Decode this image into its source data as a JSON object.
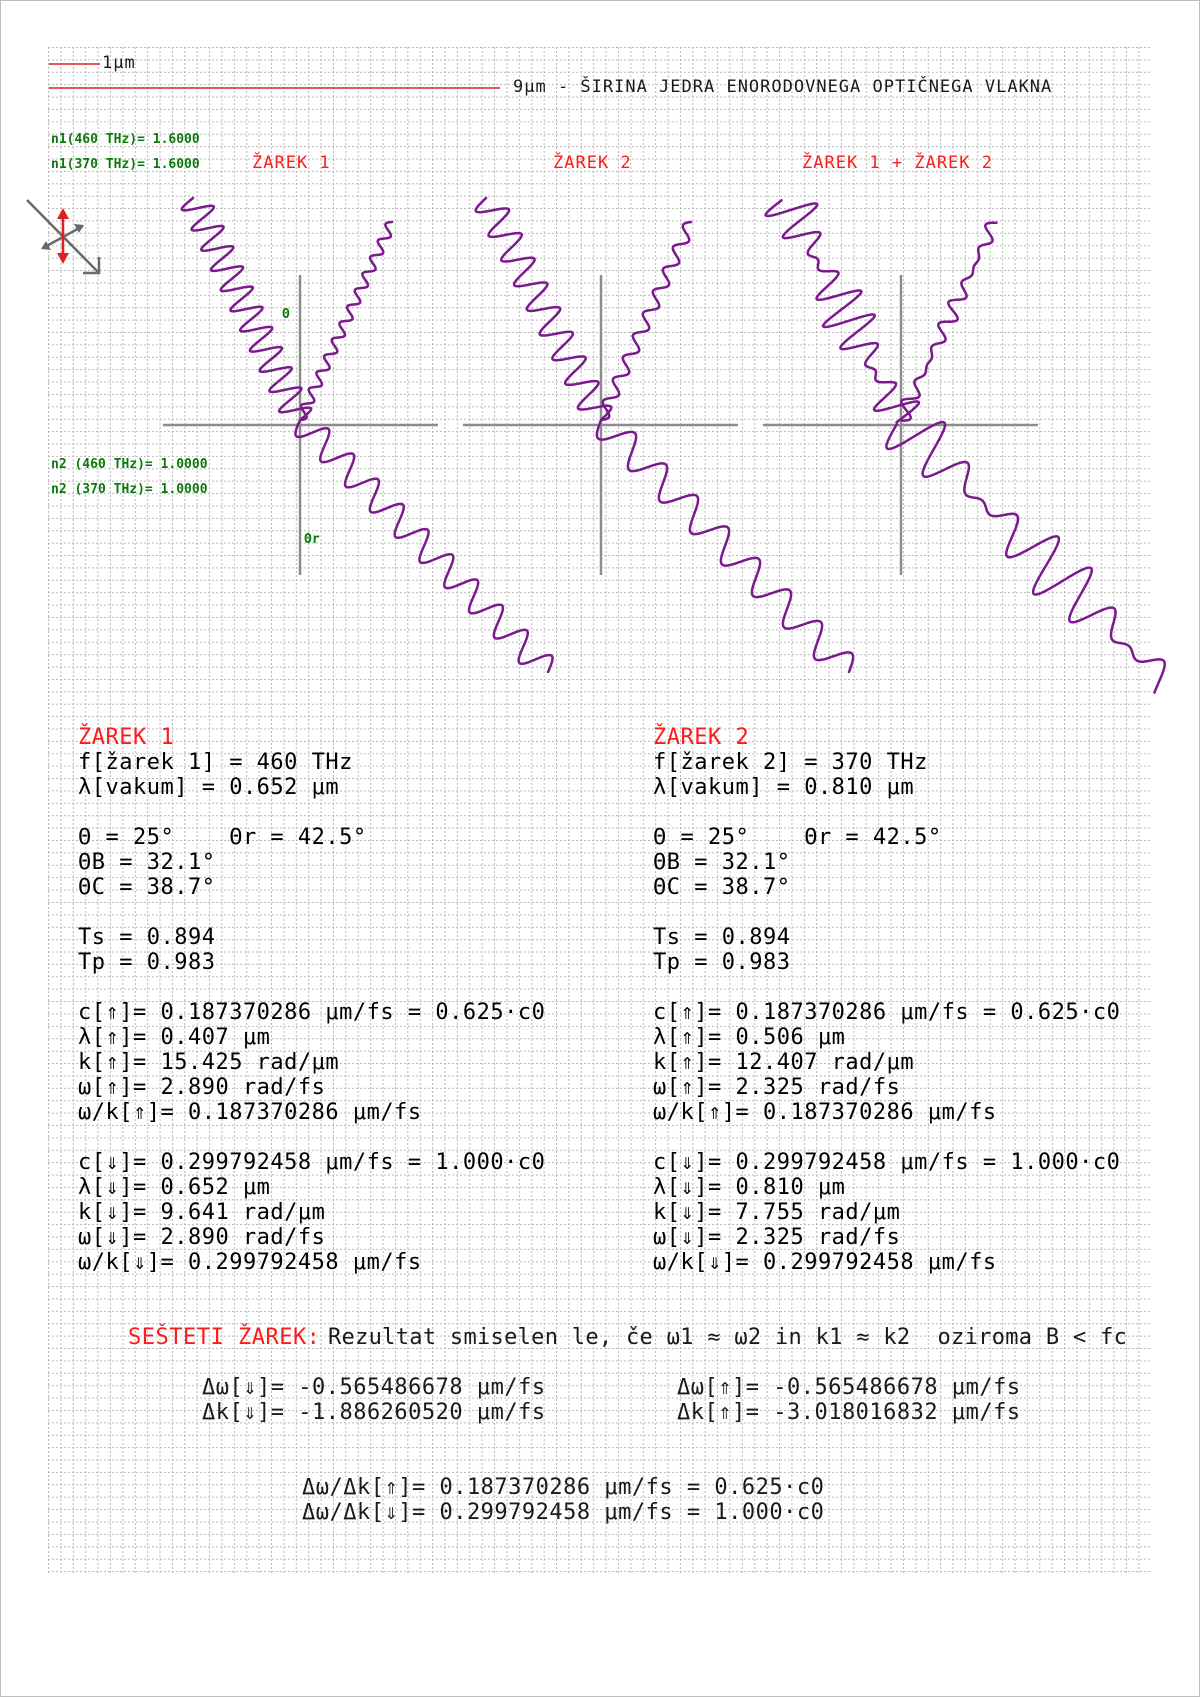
{
  "scale": {
    "small_label": "1μm",
    "large_label": "9μm - ŠIRINA JEDRA ENORODOVNEGA OPTIČNEGA VLAKNA"
  },
  "indices": {
    "n1_460": "n1(460 THz)= 1.6000",
    "n1_370": "n1(370 THz)= 1.6000",
    "n2_460": "n2 (460 THz)= 1.0000",
    "n2_370": "n2 (370 THz)= 1.0000"
  },
  "panels": {
    "p1_title": "ŽAREK 1",
    "p2_title": "ŽAREK 2",
    "p3_title": "ŽAREK 1 + ŽAREK 2",
    "theta_label": "Θ",
    "theta_r_label": "Θr"
  },
  "colors": {
    "wave": "#7a1a8c",
    "title_red": "#ff1a1a",
    "index_green": "#0a7a0a",
    "axis_gray": "#8c8c8c"
  },
  "beam1": {
    "title": "ŽAREK 1",
    "lines": [
      "f[žarek 1] = 460 THz",
      "λ[vakum] = 0.652 μm",
      "",
      "Θ = 25°    Θr = 42.5°",
      "ΘB = 32.1°",
      "ΘC = 38.7°",
      "",
      "Ts = 0.894",
      "Tp = 0.983",
      "",
      "c[⇑]= 0.187370286 μm/fs = 0.625·c0",
      "λ[⇑]= 0.407 μm",
      "k[⇑]= 15.425 rad/μm",
      "ω[⇑]= 2.890 rad/fs",
      "ω/k[⇑]= 0.187370286 μm/fs",
      "",
      "c[⇓]= 0.299792458 μm/fs = 1.000·c0",
      "λ[⇓]= 0.652 μm",
      "k[⇓]= 9.641 rad/μm",
      "ω[⇓]= 2.890 rad/fs",
      "ω/k[⇓]= 0.299792458 μm/fs"
    ]
  },
  "beam2": {
    "title": "ŽAREK 2",
    "lines": [
      "f[žarek 2] = 370 THz",
      "λ[vakum] = 0.810 μm",
      "",
      "Θ = 25°    Θr = 42.5°",
      "ΘB = 32.1°",
      "ΘC = 38.7°",
      "",
      "Ts = 0.894",
      "Tp = 0.983",
      "",
      "c[⇑]= 0.187370286 μm/fs = 0.625·c0",
      "λ[⇑]= 0.506 μm",
      "k[⇑]= 12.407 rad/μm",
      "ω[⇑]= 2.325 rad/fs",
      "ω/k[⇑]= 0.187370286 μm/fs",
      "",
      "c[⇓]= 0.299792458 μm/fs = 1.000·c0",
      "λ[⇓]= 0.810 μm",
      "k[⇓]= 7.755 rad/μm",
      "ω[⇓]= 2.325 rad/fs",
      "ω/k[⇓]= 0.299792458 μm/fs"
    ]
  },
  "sum": {
    "label": "SEŠTETI ŽAREK:",
    "note": "Rezultat smiselen le, če ω1 ≈ ω2 in k1 ≈ k2  oziroma B < fc",
    "dw_down": "Δω[⇓]= -0.565486678 μm/fs",
    "dk_down": "Δk[⇓]= -1.886260520 μm/fs",
    "dw_up": "Δω[⇑]= -0.565486678 μm/fs",
    "dk_up": "Δk[⇑]= -3.018016832 μm/fs",
    "ratio_up": "Δω/Δk[⇑]= 0.187370286 μm/fs = 0.625·c0",
    "ratio_down": "Δω/Δk[⇓]= 0.299792458 μm/fs = 1.000·c0"
  }
}
